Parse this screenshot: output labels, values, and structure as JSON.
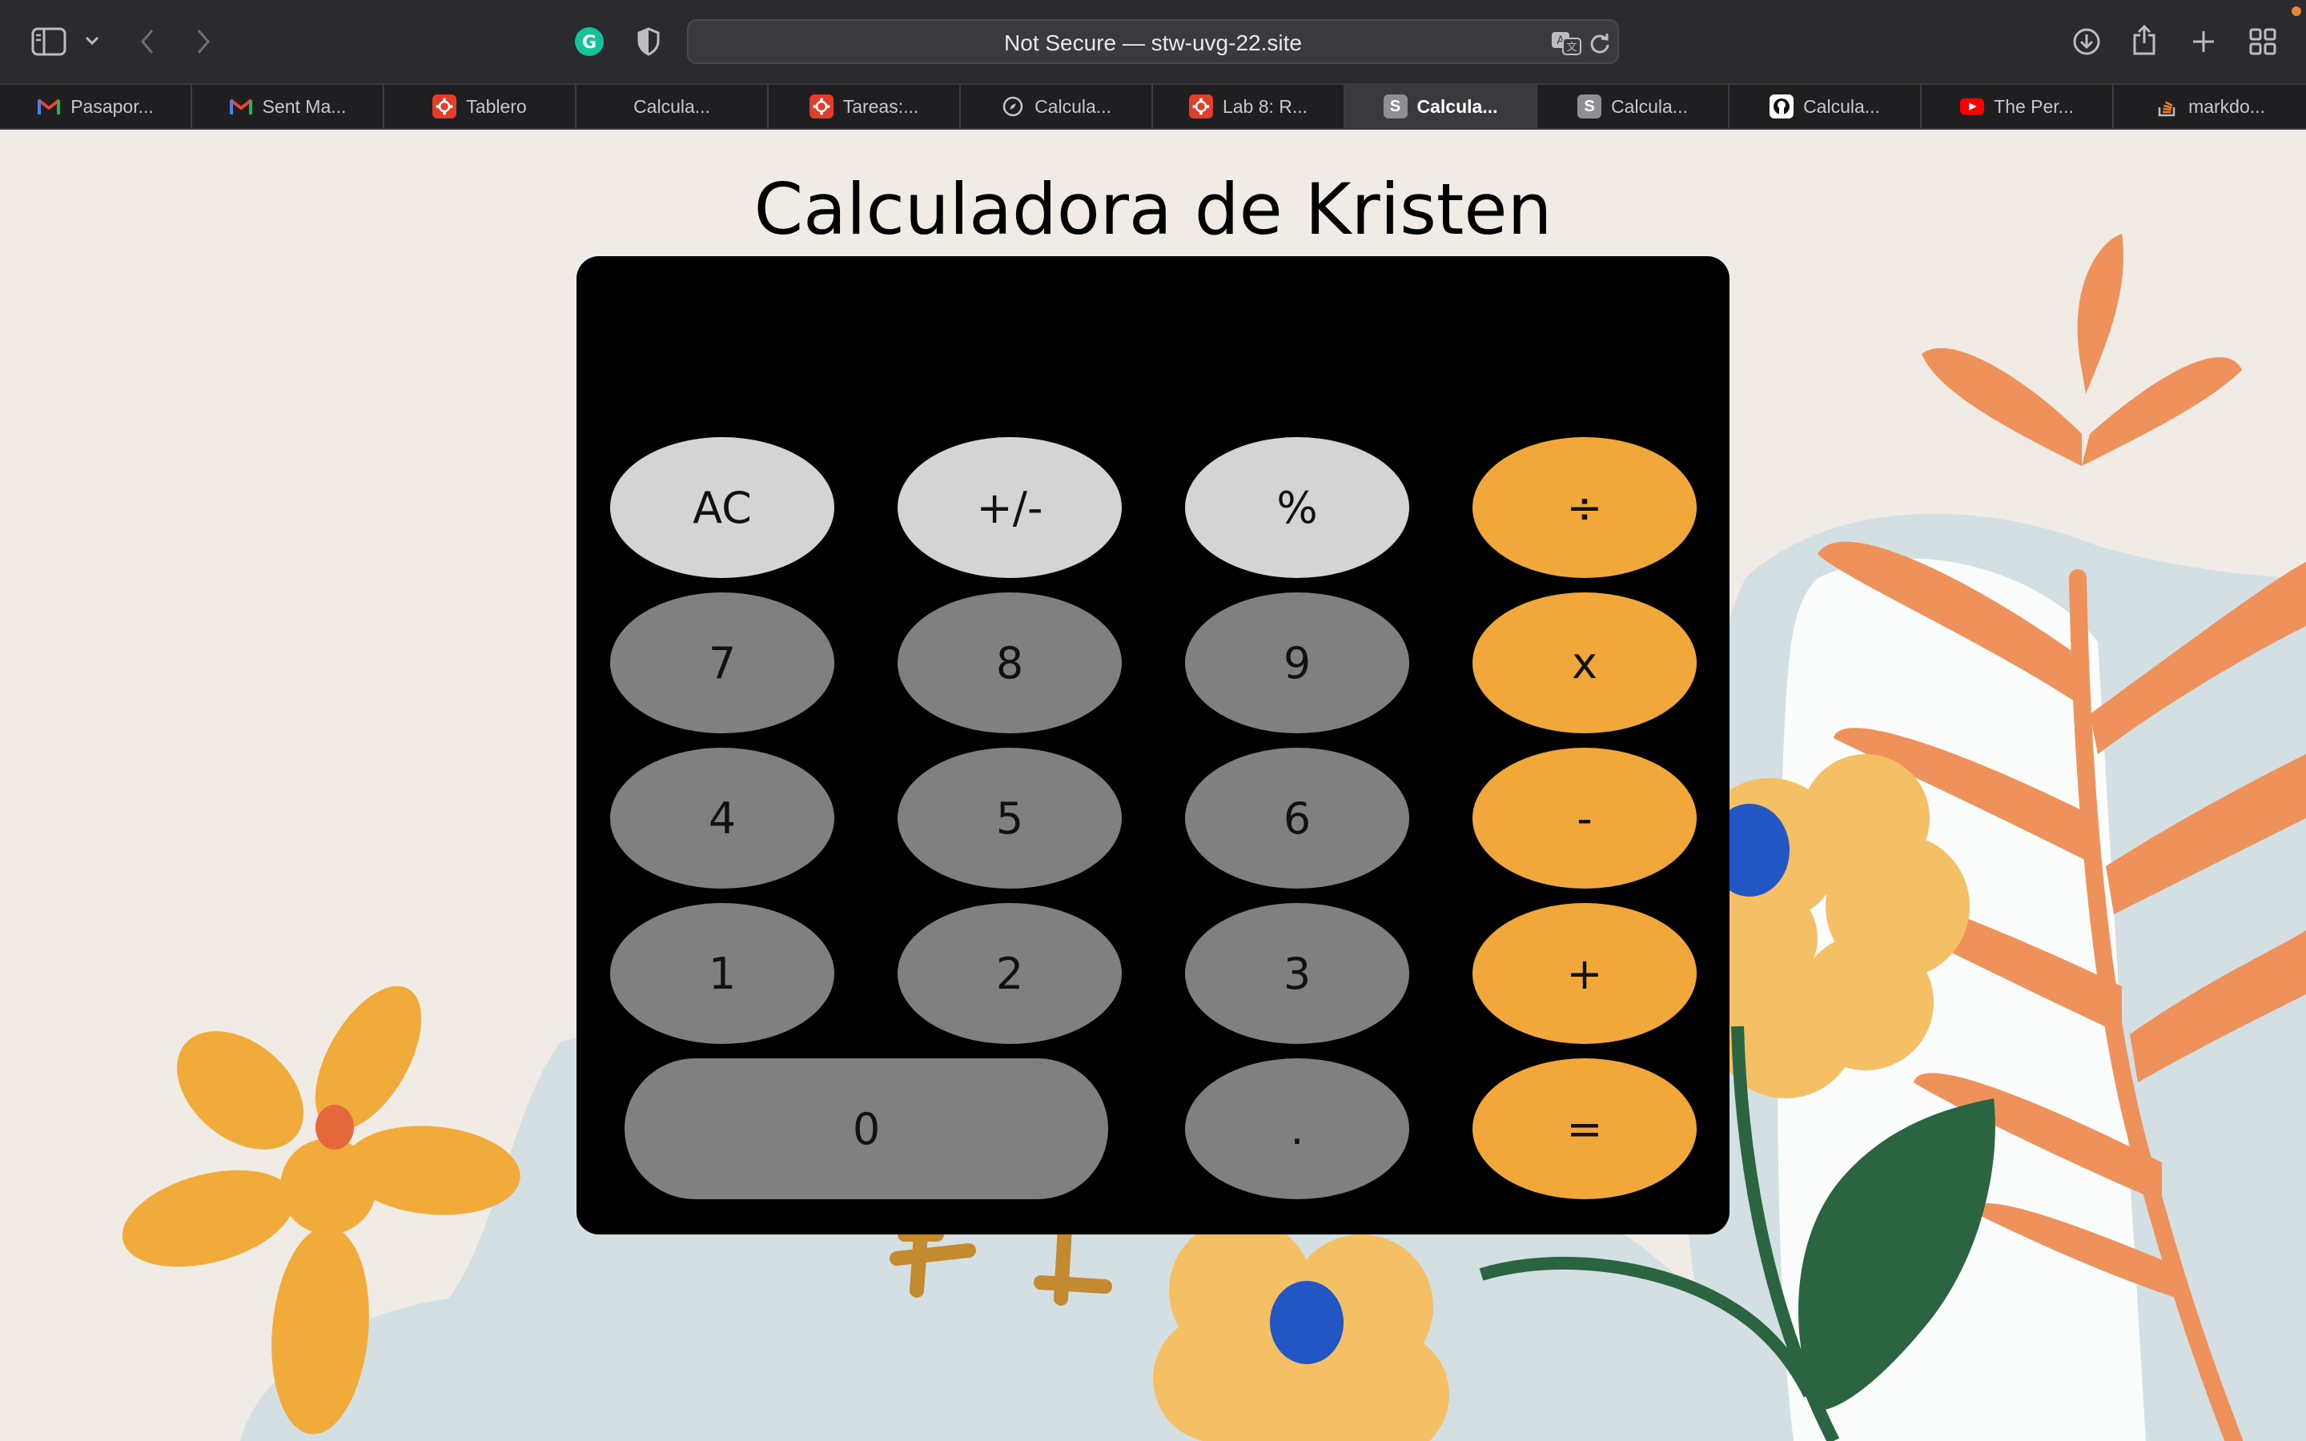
{
  "browser": {
    "address": "Not Secure — stw-uvg-22.site",
    "tabs": [
      {
        "label": "Pasapor...",
        "icon": "gmail-icon"
      },
      {
        "label": "Sent Ma...",
        "icon": "gmail-icon"
      },
      {
        "label": "Tablero",
        "icon": "canvas-icon"
      },
      {
        "label": "Calcula...",
        "icon": ""
      },
      {
        "label": "Tareas:...",
        "icon": "canvas-icon"
      },
      {
        "label": "Calcula...",
        "icon": "compass-icon"
      },
      {
        "label": "Lab 8: R...",
        "icon": "canvas-icon"
      },
      {
        "label": "Calcula...",
        "icon": "site-s-icon",
        "active": true
      },
      {
        "label": "Calcula...",
        "icon": "site-s-icon"
      },
      {
        "label": "Calcula...",
        "icon": "github-icon"
      },
      {
        "label": "The Per...",
        "icon": "youtube-icon"
      },
      {
        "label": "markdo...",
        "icon": "stackoverflow-icon"
      }
    ],
    "colors": {
      "toolbar": "#2b2a2e",
      "tabbar": "#1f1f22"
    }
  },
  "page": {
    "title": "Calculadora de Kristen",
    "display": "",
    "keys": {
      "ac": "AC",
      "sign": "+/-",
      "percent": "%",
      "divide": "÷",
      "seven": "7",
      "eight": "8",
      "nine": "9",
      "multiply": "x",
      "four": "4",
      "five": "5",
      "six": "6",
      "minus": "-",
      "one": "1",
      "two": "2",
      "three": "3",
      "plus": "+",
      "zero": "0",
      "decimal": ".",
      "equals": "="
    },
    "colors": {
      "background": "#f0ebe5",
      "operator": "#f1a73a",
      "function": "#d4d4d4",
      "digit": "#808080",
      "body": "#000000"
    }
  }
}
